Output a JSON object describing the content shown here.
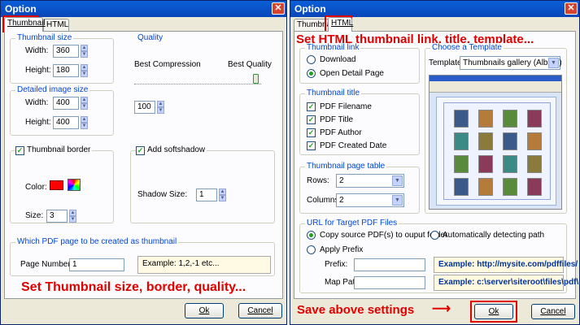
{
  "left": {
    "title": "Option",
    "close_glyph": "✕",
    "tabs": [
      "Thumbnail",
      "HTML"
    ],
    "thumbnail_size": {
      "legend": "Thumbnail size",
      "width_label": "Width:",
      "width": "360",
      "height_label": "Height:",
      "height": "180"
    },
    "quality": {
      "legend": "Quality",
      "min_label": "Best Compression",
      "max_label": "Best Quality",
      "value": "100"
    },
    "detailed_size": {
      "legend": "Detailed image size",
      "width_label": "Width:",
      "width": "400",
      "height_label": "Height:",
      "height": "400"
    },
    "border": {
      "label": "Thumbnail border",
      "checked": true,
      "color_label": "Color:",
      "color": "#ff0000",
      "size_label": "Size:",
      "size": "3"
    },
    "shadow": {
      "label": "Add softshadow",
      "checked": true,
      "size_label": "Shadow Size:",
      "size": "1"
    },
    "page": {
      "legend": "Which PDF page to be created as thumbnail",
      "label": "Page Number:",
      "value": "1",
      "example": "Example: 1,2,-1 etc..."
    },
    "annotation": "Set Thumbnail size, border, quality...",
    "ok": "Ok",
    "cancel": "Cancel"
  },
  "right": {
    "title": "Option",
    "close_glyph": "✕",
    "tabs": [
      "Thumbnail",
      "HTML"
    ],
    "annotation": "Set HTML thumbnail link, title, template...",
    "link": {
      "legend": "Thumbnail link",
      "options": [
        "Download",
        "Open Detail Page"
      ],
      "selected": 1
    },
    "title_group": {
      "legend": "Thumbnail title",
      "items": [
        "PDF Filename",
        "PDF Title",
        "PDF Author",
        "PDF Created Date"
      ]
    },
    "table": {
      "legend": "Thumbnail page table",
      "rows_label": "Rows:",
      "rows": "2",
      "cols_label": "Columns:",
      "cols": "2"
    },
    "template": {
      "legend": "Choose a Template",
      "label": "Template:",
      "value": "Thumbnails gallery (Album)"
    },
    "url": {
      "legend": "URL for Target PDF Files",
      "copy_label": "Copy source PDF(s) to ouput folder",
      "auto_label": "Automatically detecting path",
      "prefix_option": "Apply Prefix",
      "prefix_label": "Prefix:",
      "map_label": "Map Path:",
      "example_prefix": "Example: http://mysite.com/pdffiles/",
      "example_map": "Example: c:\\server\\siteroot\\files\\pdf\\"
    },
    "save_annotation": "Save above settings",
    "ok": "Ok",
    "cancel": "Cancel"
  }
}
